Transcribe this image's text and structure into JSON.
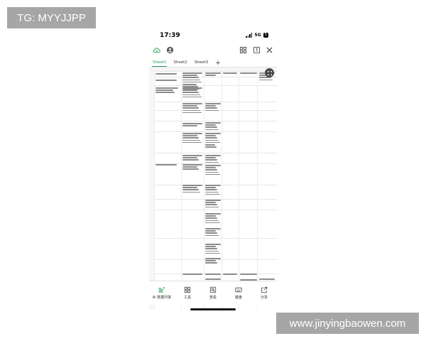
{
  "watermarks": {
    "top": "TG: MYYJJPP",
    "bottom": "www.jinyingbaowen.com"
  },
  "statusbar": {
    "time": "17:39",
    "network": "5G",
    "battery": "5"
  },
  "toolbar": {
    "icons": [
      "cloud-sync-icon",
      "avatar-icon",
      "grid-view-icon",
      "page-count-icon",
      "close-icon"
    ]
  },
  "tabs": [
    {
      "label": "Sheet1",
      "active": true
    },
    {
      "label": "Sheet2",
      "active": false
    },
    {
      "label": "Sheet3",
      "active": false
    }
  ],
  "bottom_toolbar": [
    {
      "label": "AI 数据问答",
      "icon": "ai-chart-icon"
    },
    {
      "label": "工具",
      "icon": "tools-icon"
    },
    {
      "label": "查看",
      "icon": "view-icon"
    },
    {
      "label": "键盘",
      "icon": "keyboard-icon"
    },
    {
      "label": "分享",
      "icon": "share-icon"
    }
  ],
  "colors": {
    "accent": "#1e9e4f",
    "watermark_bg": "#a6a6a6"
  }
}
